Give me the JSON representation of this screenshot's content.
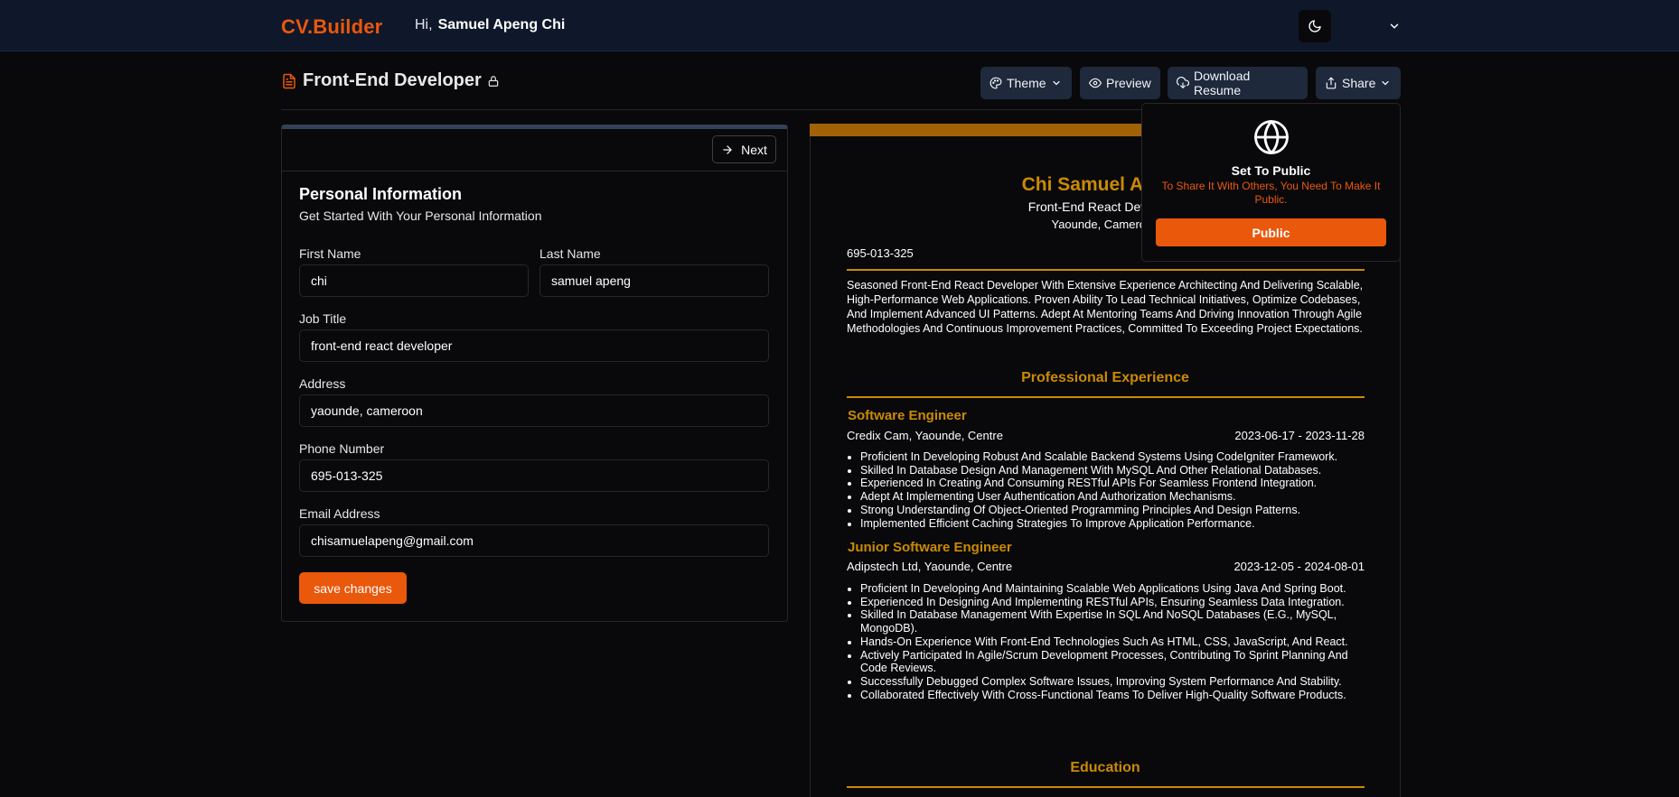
{
  "app": {
    "logo": "CV.Builder",
    "greeting": "Hi,",
    "user_name": "Samuel Apeng Chi"
  },
  "icons": {
    "theme_toggle": "moon-icon",
    "user_menu": "chevron-down-icon",
    "document": "file-text-icon",
    "lock": "lock-icon",
    "globe": "globe-icon"
  },
  "header": {
    "title": "Front-End Developer"
  },
  "toolbar": {
    "theme_label": "Theme",
    "preview_label": "Preview",
    "download_label": "Download Resume",
    "share_label": "Share"
  },
  "form": {
    "next_label": "Next",
    "section_title": "Personal Information",
    "section_subtitle": "Get Started With Your Personal Information",
    "first_name": {
      "label": "First Name",
      "value": "chi"
    },
    "last_name": {
      "label": "Last Name",
      "value": "samuel apeng"
    },
    "job_title": {
      "label": "Job Title",
      "value": "front-end react developer"
    },
    "address": {
      "label": "Address",
      "value": "yaounde, cameroon"
    },
    "phone": {
      "label": "Phone Number",
      "value": "695-013-325"
    },
    "email": {
      "label": "Email Address",
      "value": "chisamuelapeng@gmail.com"
    },
    "save_label": "save changes"
  },
  "resume": {
    "name": "Chi Samuel Apeng",
    "title": "Front-End React Developer",
    "address": "Yaounde, Cameroon",
    "phone": "695-013-325",
    "summary": "Seasoned Front-End React Developer With Extensive Experience Architecting And Delivering Scalable, High-Performance Web Applications. Proven Ability To Lead Technical Initiatives, Optimize Codebases, And Implement Advanced UI Patterns. Adept At Mentoring Teams And Driving Innovation Through Agile Methodologies And Continuous Improvement Practices, Committed To Exceeding Project Expectations.",
    "experience_heading": "Professional Experience",
    "education_heading": "Education",
    "jobs": [
      {
        "title": "Software Engineer",
        "company": "Credix Cam, Yaounde, Centre",
        "dates": "2023-06-17 - 2023-11-28",
        "bullets": [
          "Proficient In Developing Robust And Scalable Backend Systems Using CodeIgniter Framework.",
          "Skilled In Database Design And Management With MySQL And Other Relational Databases.",
          "Experienced In Creating And Consuming RESTful APIs For Seamless Frontend Integration.",
          "Adept At Implementing User Authentication And Authorization Mechanisms.",
          "Strong Understanding Of Object-Oriented Programming Principles And Design Patterns.",
          "Implemented Efficient Caching Strategies To Improve Application Performance."
        ]
      },
      {
        "title": "Junior Software Engineer",
        "company": "Adipstech Ltd, Yaounde, Centre",
        "dates": "2023-12-05 - 2024-08-01",
        "bullets": [
          "Proficient In Developing And Maintaining Scalable Web Applications Using Java And Spring Boot.",
          "Experienced In Designing And Implementing RESTful APIs, Ensuring Seamless Data Integration.",
          "Skilled In Database Management With Expertise In SQL And NoSQL Databases (E.G., MySQL, MongoDB).",
          "Hands-On Experience With Front-End Technologies Such As HTML, CSS, JavaScript, And React.",
          "Actively Participated In Agile/Scrum Development Processes, Contributing To Sprint Planning And Code Reviews.",
          "Successfully Debugged Complex Software Issues, Improving System Performance And Stability.",
          "Collaborated Effectively With Cross-Functional Teams To Deliver High-Quality Software Products."
        ]
      }
    ]
  },
  "share_popover": {
    "title": "Set To Public",
    "description": "To Share It With Others, You Need To Make It Public.",
    "button_label": "Public"
  },
  "colors": {
    "accent": "#ea580c",
    "resume_accent": "#ca8a04",
    "navbar": "#0f172a",
    "background": "#09090b"
  }
}
